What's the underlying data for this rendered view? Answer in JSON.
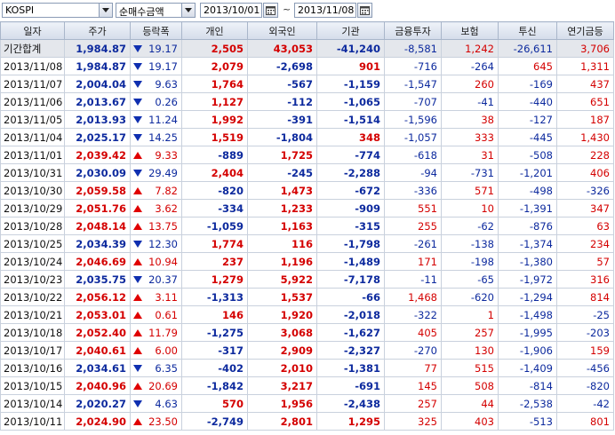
{
  "toolbar": {
    "index": "KOSPI",
    "metric": "순매수금액",
    "date_from": "2013/10/01",
    "date_to": "2013/11/08",
    "separator": "~"
  },
  "colors": {
    "up": "#d40000",
    "down": "#0d2a9e",
    "header_bg": "#d4dcea"
  },
  "columns": [
    "일자",
    "주가",
    "등락폭",
    "개인",
    "외국인",
    "기관",
    "금융투자",
    "보험",
    "투신",
    "연기금등"
  ],
  "rows": [
    {
      "date": "기간합계",
      "price": "1,984.87",
      "dir": "down",
      "change": "19.17",
      "indiv": "2,505",
      "foreign": "43,053",
      "inst": "-41,240",
      "fin": "-8,581",
      "ins": "1,242",
      "trust": "-26,611",
      "pension": "3,706"
    },
    {
      "date": "2013/11/08",
      "price": "1,984.87",
      "dir": "down",
      "change": "19.17",
      "indiv": "2,079",
      "foreign": "-2,698",
      "inst": "901",
      "fin": "-716",
      "ins": "-264",
      "trust": "645",
      "pension": "1,311"
    },
    {
      "date": "2013/11/07",
      "price": "2,004.04",
      "dir": "down",
      "change": "9.63",
      "indiv": "1,764",
      "foreign": "-567",
      "inst": "-1,159",
      "fin": "-1,547",
      "ins": "260",
      "trust": "-169",
      "pension": "437"
    },
    {
      "date": "2013/11/06",
      "price": "2,013.67",
      "dir": "down",
      "change": "0.26",
      "indiv": "1,127",
      "foreign": "-112",
      "inst": "-1,065",
      "fin": "-707",
      "ins": "-41",
      "trust": "-440",
      "pension": "651"
    },
    {
      "date": "2013/11/05",
      "price": "2,013.93",
      "dir": "down",
      "change": "11.24",
      "indiv": "1,992",
      "foreign": "-391",
      "inst": "-1,514",
      "fin": "-1,596",
      "ins": "38",
      "trust": "-127",
      "pension": "187"
    },
    {
      "date": "2013/11/04",
      "price": "2,025.17",
      "dir": "down",
      "change": "14.25",
      "indiv": "1,519",
      "foreign": "-1,804",
      "inst": "348",
      "fin": "-1,057",
      "ins": "333",
      "trust": "-445",
      "pension": "1,430"
    },
    {
      "date": "2013/11/01",
      "price": "2,039.42",
      "dir": "up",
      "change": "9.33",
      "indiv": "-889",
      "foreign": "1,725",
      "inst": "-774",
      "fin": "-618",
      "ins": "31",
      "trust": "-508",
      "pension": "228"
    },
    {
      "date": "2013/10/31",
      "price": "2,030.09",
      "dir": "down",
      "change": "29.49",
      "indiv": "2,404",
      "foreign": "-245",
      "inst": "-2,288",
      "fin": "-94",
      "ins": "-731",
      "trust": "-1,201",
      "pension": "406"
    },
    {
      "date": "2013/10/30",
      "price": "2,059.58",
      "dir": "up",
      "change": "7.82",
      "indiv": "-820",
      "foreign": "1,473",
      "inst": "-672",
      "fin": "-336",
      "ins": "571",
      "trust": "-498",
      "pension": "-326"
    },
    {
      "date": "2013/10/29",
      "price": "2,051.76",
      "dir": "up",
      "change": "3.62",
      "indiv": "-334",
      "foreign": "1,233",
      "inst": "-909",
      "fin": "551",
      "ins": "10",
      "trust": "-1,391",
      "pension": "347"
    },
    {
      "date": "2013/10/28",
      "price": "2,048.14",
      "dir": "up",
      "change": "13.75",
      "indiv": "-1,059",
      "foreign": "1,163",
      "inst": "-315",
      "fin": "255",
      "ins": "-62",
      "trust": "-876",
      "pension": "63"
    },
    {
      "date": "2013/10/25",
      "price": "2,034.39",
      "dir": "down",
      "change": "12.30",
      "indiv": "1,774",
      "foreign": "116",
      "inst": "-1,798",
      "fin": "-261",
      "ins": "-138",
      "trust": "-1,374",
      "pension": "234"
    },
    {
      "date": "2013/10/24",
      "price": "2,046.69",
      "dir": "up",
      "change": "10.94",
      "indiv": "237",
      "foreign": "1,196",
      "inst": "-1,489",
      "fin": "171",
      "ins": "-198",
      "trust": "-1,380",
      "pension": "57"
    },
    {
      "date": "2013/10/23",
      "price": "2,035.75",
      "dir": "down",
      "change": "20.37",
      "indiv": "1,279",
      "foreign": "5,922",
      "inst": "-7,178",
      "fin": "-11",
      "ins": "-65",
      "trust": "-1,972",
      "pension": "316"
    },
    {
      "date": "2013/10/22",
      "price": "2,056.12",
      "dir": "up",
      "change": "3.11",
      "indiv": "-1,313",
      "foreign": "1,537",
      "inst": "-66",
      "fin": "1,468",
      "ins": "-620",
      "trust": "-1,294",
      "pension": "814"
    },
    {
      "date": "2013/10/21",
      "price": "2,053.01",
      "dir": "up",
      "change": "0.61",
      "indiv": "146",
      "foreign": "1,920",
      "inst": "-2,018",
      "fin": "-322",
      "ins": "1",
      "trust": "-1,498",
      "pension": "-25"
    },
    {
      "date": "2013/10/18",
      "price": "2,052.40",
      "dir": "up",
      "change": "11.79",
      "indiv": "-1,275",
      "foreign": "3,068",
      "inst": "-1,627",
      "fin": "405",
      "ins": "257",
      "trust": "-1,995",
      "pension": "-203"
    },
    {
      "date": "2013/10/17",
      "price": "2,040.61",
      "dir": "up",
      "change": "6.00",
      "indiv": "-317",
      "foreign": "2,909",
      "inst": "-2,327",
      "fin": "-270",
      "ins": "130",
      "trust": "-1,906",
      "pension": "159"
    },
    {
      "date": "2013/10/16",
      "price": "2,034.61",
      "dir": "down",
      "change": "6.35",
      "indiv": "-402",
      "foreign": "2,010",
      "inst": "-1,381",
      "fin": "77",
      "ins": "515",
      "trust": "-1,409",
      "pension": "-456"
    },
    {
      "date": "2013/10/15",
      "price": "2,040.96",
      "dir": "up",
      "change": "20.69",
      "indiv": "-1,842",
      "foreign": "3,217",
      "inst": "-691",
      "fin": "145",
      "ins": "508",
      "trust": "-814",
      "pension": "-820"
    },
    {
      "date": "2013/10/14",
      "price": "2,020.27",
      "dir": "down",
      "change": "4.63",
      "indiv": "570",
      "foreign": "1,956",
      "inst": "-2,438",
      "fin": "257",
      "ins": "44",
      "trust": "-2,538",
      "pension": "-42"
    },
    {
      "date": "2013/10/11",
      "price": "2,024.90",
      "dir": "up",
      "change": "23.50",
      "indiv": "-2,749",
      "foreign": "2,801",
      "inst": "1,295",
      "fin": "325",
      "ins": "403",
      "trust": "-513",
      "pension": "801"
    }
  ]
}
